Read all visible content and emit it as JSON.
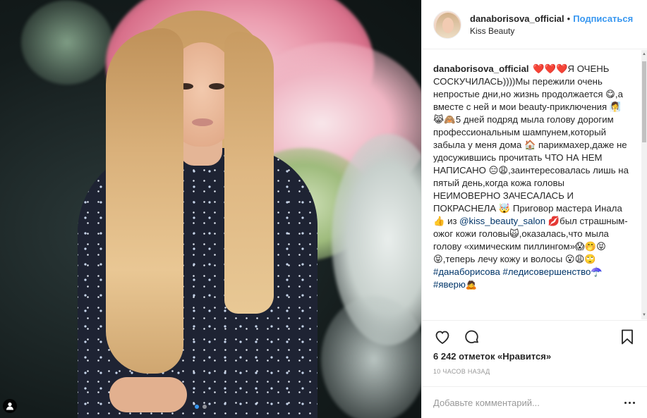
{
  "post": {
    "username": "danaborisova_official",
    "separator": "•",
    "follow_label": "Подписаться",
    "location": "Kiss Beauty"
  },
  "caption": {
    "username": "danaborisova_official",
    "text_1": "❤️❤️❤️Я ОЧЕНЬ СОСКУЧИЛАСЬ))))Мы пережили очень непростые дни,но жизнь продолжается 😋,а вместе с ней и мои beauty-приключения 🧖‍♀️😹🙈5 дней подряд мыла голову дорогим профессиональным шампунем,который забыла у меня дома 🏠 парикмахер,даже не удосужившись прочитать ЧТО НА НЕМ НАПИСАНО 😑😩,заинтересовалась лишь на пятый день,когда кожа головы НЕИМОВЕРНО ЗАЧЕСАЛАСЬ И ПОКРАСНЕЛА 🤯 Приговор мастера Инала 👍 из",
    "mention": "@kiss_beauty_salon",
    "text_2": " 💋был страшным-ожог кожи головы🙀,оказалась,что мыла голову «химическим пиллингом»😱🤭😝😝,теперь лечу кожу и волосы 😮😩🙄",
    "hashtag_1": "#данаборисова",
    "hashtag_2": "#ледисовершенство☂️",
    "hashtag_3": "#яверю🙇"
  },
  "actions": {
    "like_icon": "heart-icon",
    "comment_icon": "comment-icon",
    "save_icon": "bookmark-icon"
  },
  "likes_text": "6 242 отметок «Нравится»",
  "time_text": "10 ЧАСОВ НАЗАД",
  "comment": {
    "placeholder": "Добавьте комментарий...",
    "value": ""
  },
  "carousel": {
    "count": 2,
    "active_index": 0
  },
  "colors": {
    "link": "#3897f0",
    "hashtag": "#003569",
    "text": "#262626",
    "muted": "#999999"
  }
}
